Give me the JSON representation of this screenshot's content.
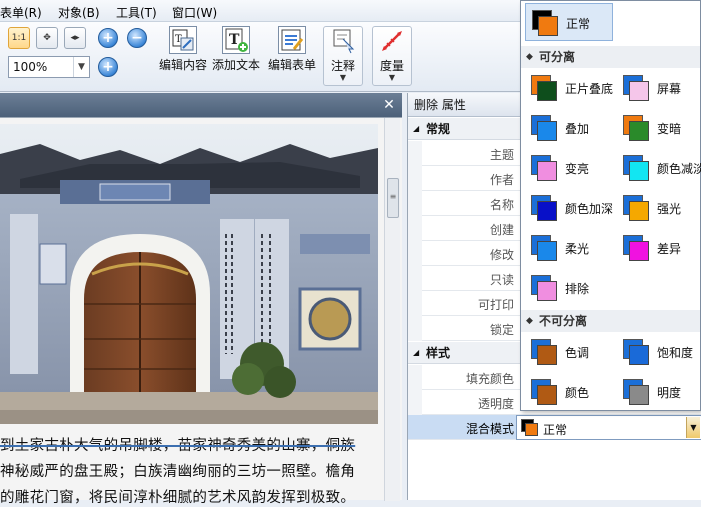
{
  "menubar": {
    "items": [
      "表单(R)",
      "对象(B)",
      "工具(T)",
      "窗口(W)"
    ]
  },
  "toolbar": {
    "zoom_value": "100%",
    "edit_content": "编辑内容",
    "add_text": "添加文本",
    "edit_form": "编辑表单",
    "annotate": "注释",
    "measure": "度量",
    "actual_size": "1:1"
  },
  "document": {
    "lines": [
      "到土家古朴大气的吊脚楼，苗家神奇秀美的山寨，侗族",
      "神秘威严的盘王殿；白族清幽绚丽的三坊一照壁。檐角",
      "的雕花门窗，将民间淳朴细腻的艺术风韵发挥到极致。"
    ]
  },
  "properties": {
    "header": "删除 属性",
    "sections": [
      {
        "title": "常规",
        "rows": [
          "主题",
          "作者",
          "名称",
          "创建",
          "修改",
          "只读",
          "可打印",
          "锁定"
        ]
      },
      {
        "title": "样式",
        "rows": [
          "填充颜色",
          "透明度",
          "混合模式"
        ]
      }
    ],
    "blend_mode_value": "正常"
  },
  "blend_dropdown": {
    "top_option": {
      "label": "正常",
      "back": "#000000",
      "front": "#f07a10"
    },
    "separable_title": "可分离",
    "separable": [
      {
        "label": "正片叠底",
        "back": "#f07a10",
        "front": "#0e4e1c"
      },
      {
        "label": "屏幕",
        "back": "#1b6fd8",
        "front": "#f5c6ea"
      },
      {
        "label": "叠加",
        "back": "#1b6fd8",
        "front": "#1a88ea"
      },
      {
        "label": "变暗",
        "back": "#f07a10",
        "front": "#2a8a2a"
      },
      {
        "label": "变亮",
        "back": "#1b6fd8",
        "front": "#f08ee0"
      },
      {
        "label": "颜色减淡",
        "back": "#1b6fd8",
        "front": "#12e6f2"
      },
      {
        "label": "颜色加深",
        "back": "#1b6fd8",
        "front": "#0810c8"
      },
      {
        "label": "强光",
        "back": "#1b6fd8",
        "front": "#f5a800"
      },
      {
        "label": "柔光",
        "back": "#1b6fd8",
        "front": "#1a88ea"
      },
      {
        "label": "差异",
        "back": "#1b6fd8",
        "front": "#f012e0"
      },
      {
        "label": "排除",
        "back": "#1b6fd8",
        "front": "#f08ee0"
      }
    ],
    "nonseparable_title": "不可分离",
    "nonseparable": [
      {
        "label": "色调",
        "back": "#1b6fd8",
        "front": "#b05a14"
      },
      {
        "label": "饱和度",
        "back": "#1b6fd8",
        "front": "#1a6ad8"
      },
      {
        "label": "颜色",
        "back": "#1b6fd8",
        "front": "#b05a14"
      },
      {
        "label": "明度",
        "back": "#1b6fd8",
        "front": "#8a8a8a"
      }
    ]
  }
}
